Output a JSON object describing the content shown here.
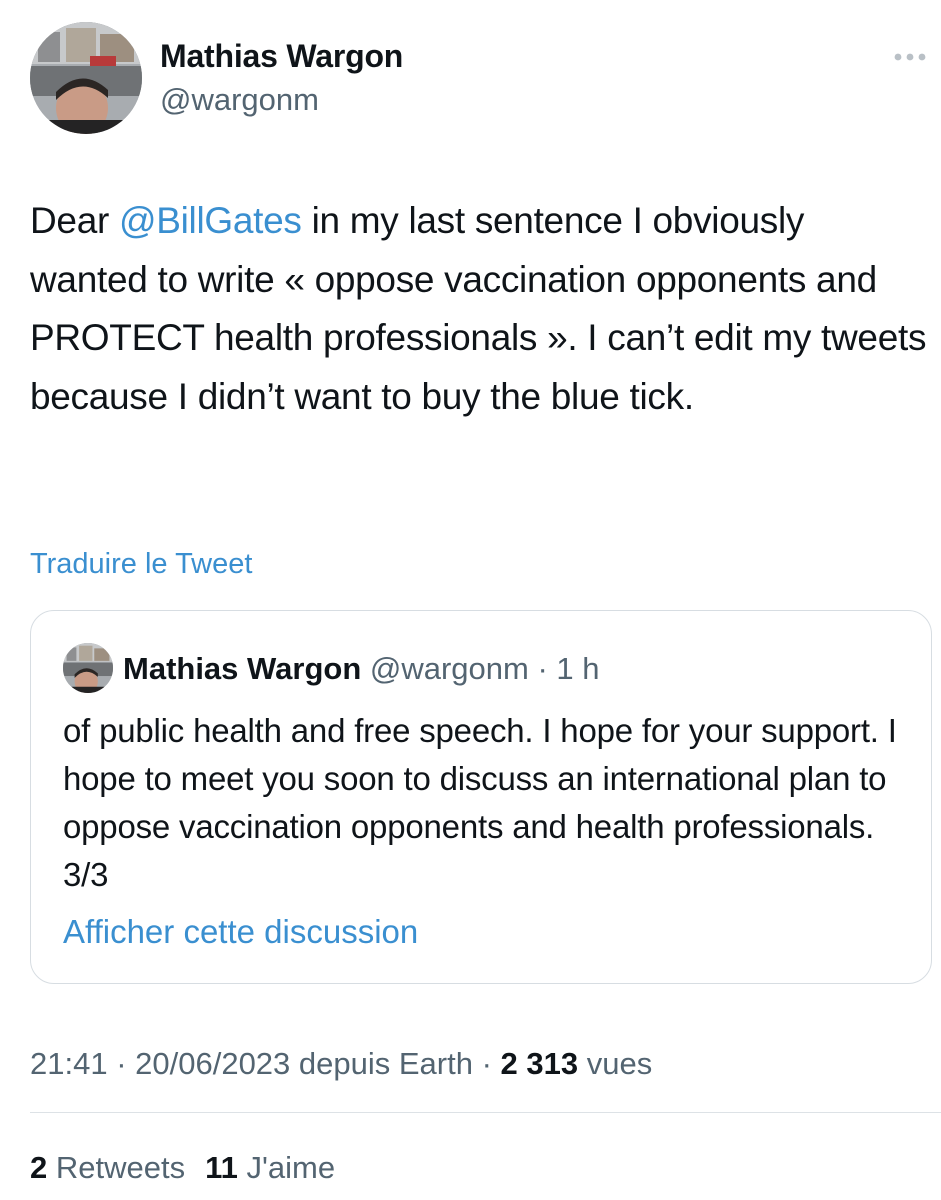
{
  "author": {
    "name": "Mathias Wargon",
    "handle": "@wargonm"
  },
  "tweet": {
    "text_before_mention": "Dear ",
    "mention": "@BillGates",
    "text_after_mention": " in my last sentence I obviously wanted to write « oppose vaccination opponents and PROTECT  health professionals ». I can’t edit my tweets because I didn’t want to buy the blue tick."
  },
  "translate_label": "Traduire le Tweet",
  "quoted_tweet": {
    "name": "Mathias Wargon",
    "handle": "@wargonm",
    "separator": " · ",
    "time": "1 h",
    "text": "of public health and free speech. I hope for your support. I hope to meet you soon to discuss an international plan to oppose vaccination opponents and health professionals. 3/3",
    "show_thread_label": "Afficher cette discussion"
  },
  "meta": {
    "time": "21:41",
    "sep1": " · ",
    "date": "20/06/2023",
    "source": " depuis Earth",
    "sep2": " · ",
    "views_count": "2 313",
    "views_label": " vues"
  },
  "stats": {
    "retweets_count": "2",
    "retweets_label": " Retweets",
    "likes_count": "11",
    "likes_label": " J'aime"
  },
  "colors": {
    "link": "#3a8fd0",
    "secondary_text": "#536471",
    "primary_text": "#0f1419",
    "border": "#d7dde2"
  },
  "icons": {
    "more": "more-horizontal-icon"
  }
}
